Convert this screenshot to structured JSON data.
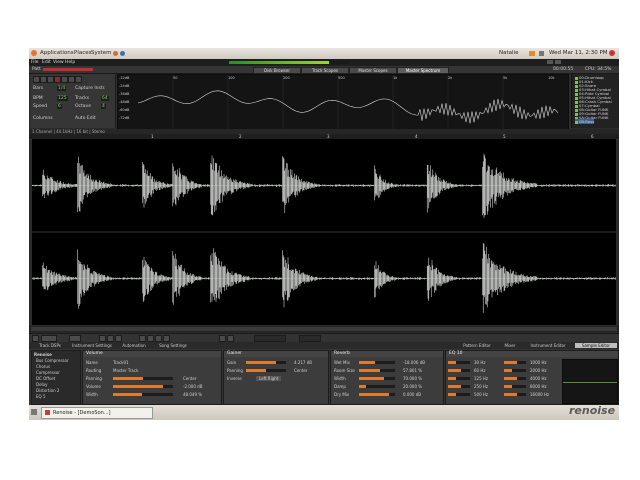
{
  "panel": {
    "menus": [
      "Applications",
      "Places",
      "System"
    ],
    "user": "Natalie",
    "clock": "Wed Mar 11,  2:30 PM"
  },
  "menubar": {
    "items": [
      "File",
      "Edit",
      "View",
      "Help"
    ]
  },
  "toolbar": {
    "left_label": "Patt",
    "tabs": [
      "Disk Browser",
      "Track Scopes",
      "Master Scopes",
      "Master Spectrum"
    ],
    "active_tab": 3,
    "right_readouts": [
      "00:00:55",
      "CPU: 34.5%"
    ]
  },
  "controls": {
    "row1": [
      {
        "label": "Bars",
        "value": "1/4"
      },
      {
        "label": "Capture Instr.",
        "value": ""
      }
    ],
    "row2": [
      {
        "label": "BPM",
        "value": "125"
      },
      {
        "label": "Tracks",
        "value": "64"
      }
    ],
    "row3": [
      {
        "label": "Speed",
        "value": "6"
      },
      {
        "label": "Octave",
        "value": "4"
      }
    ],
    "row4": [
      {
        "label": "Columns",
        "value": ""
      },
      {
        "label": "Auto Edit",
        "value": ""
      }
    ]
  },
  "spectrum": {
    "db_labels": [
      "-12dB",
      "-24dB",
      "-36dB",
      "-48dB",
      "-60dB",
      "-72dB"
    ],
    "freq_labels": [
      "50",
      "100",
      "200",
      "500",
      "1k",
      "2k",
      "5k",
      "10k"
    ]
  },
  "instruments": [
    "00:Drumloop",
    "01:Kick",
    "02:Snare",
    "03:Hihat Cymbal",
    "04:Ride Cymbal",
    "05:Hihat Cymbal",
    "06:Crash Cymbal",
    "07:Cymbal",
    "08:Guitar FUNK",
    "09:Guitar FUNK",
    "0A:Guitar FUNK",
    "0B:Bass"
  ],
  "sample_header": "1 Channel | 44.1kHz | 16 bit | Stereo",
  "ruler_marks": [
    "1",
    "2",
    "3",
    "4",
    "5",
    "6"
  ],
  "lower_tabs": {
    "left": [
      "Track DSPs",
      "Instrument Settings",
      "Automation",
      "Song Settings"
    ],
    "right": [
      "Pattern Editor",
      "Mixer",
      "Instrument Editor",
      "Sample Editor"
    ],
    "active_right": 3
  },
  "devices": {
    "mixer": {
      "title": "Volume",
      "labels": [
        "Name",
        "Routing",
        "Panning",
        "Volume",
        "Width"
      ],
      "values": [
        "Track01",
        "Master Track",
        "Center",
        "-2.000 dB",
        "48.049 %"
      ]
    },
    "gainer": {
      "title": "Gainer",
      "labels": [
        "Gain",
        "Panning",
        "Inverse"
      ],
      "values": [
        "4.217 dB",
        "Center",
        "Left  Right"
      ]
    },
    "reverb": {
      "title": "Reverb",
      "labels": [
        "Wet Mix",
        "Room Size",
        "Width",
        "Damp",
        "Dry Mix"
      ],
      "values": [
        "-18.006 dB",
        "57.801 %",
        "70.000 %",
        "20.000 %",
        "0.000 dB"
      ]
    },
    "eq": {
      "title": "EQ 10",
      "freqs": [
        "30 Hz",
        "60 Hz",
        "125 Hz",
        "250 Hz",
        "500 Hz",
        "1000 Hz",
        "2000 Hz",
        "4000 Hz",
        "8000 Hz",
        "16000 Hz"
      ]
    }
  },
  "dsp_list": [
    "Renoise",
    "Bus Compressor",
    "Chorus",
    "Compressor",
    "DC Offset",
    "Delay",
    "Distortion 2",
    "EQ 5"
  ],
  "taskbar": {
    "items": [
      "Renoise - [DemoSon...]"
    ]
  },
  "brand": "renoise",
  "colors": {
    "accent": "#e07b2e",
    "green": "#7ddc5a",
    "wave": "#ffffff"
  }
}
